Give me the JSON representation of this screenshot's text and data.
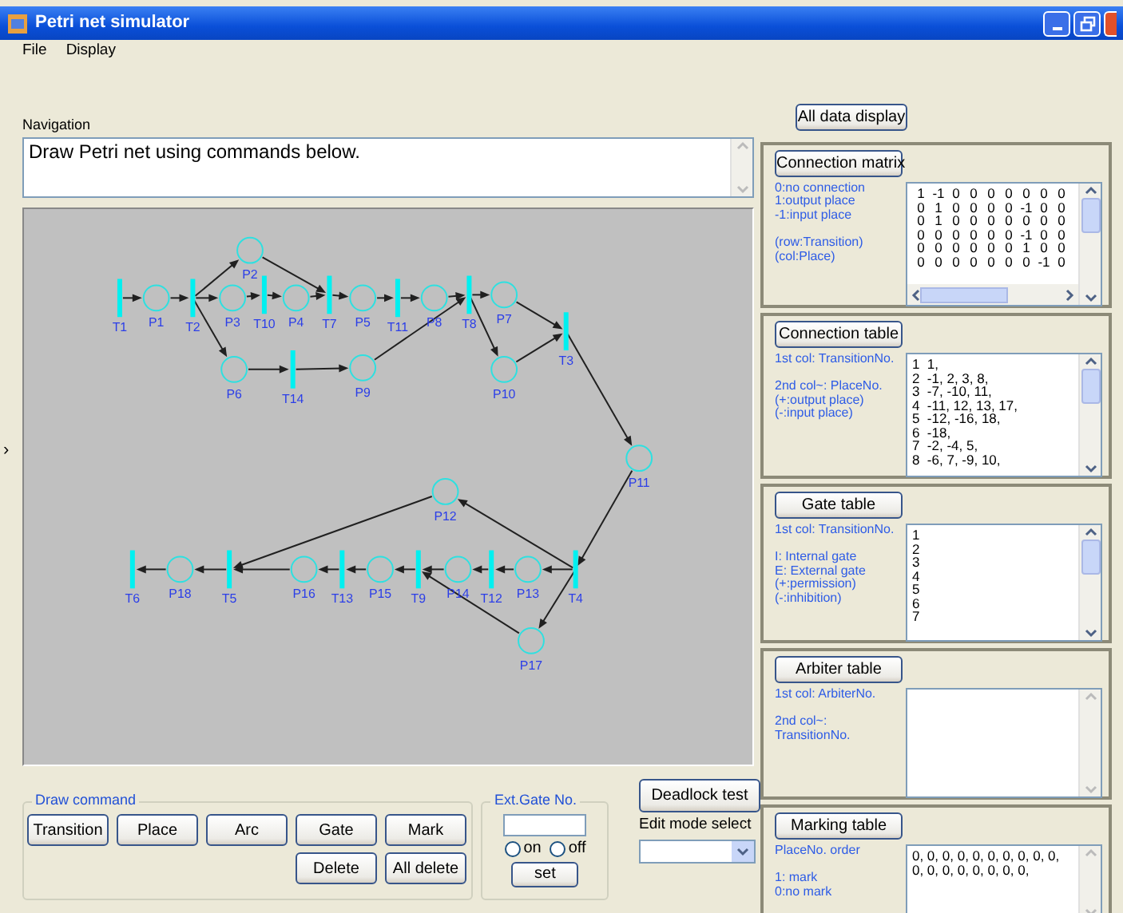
{
  "window": {
    "title": "Petri net simulator"
  },
  "menu": [
    "File",
    "Display"
  ],
  "navigation": {
    "label": "Navigation",
    "text": "Draw Petri net using commands below."
  },
  "side_marker": "›",
  "net": {
    "nodes": [
      {
        "label": "T1",
        "kind": "transition"
      },
      {
        "label": "P1",
        "kind": "place"
      },
      {
        "label": "T2",
        "kind": "transition"
      },
      {
        "label": "P2",
        "kind": "place"
      },
      {
        "label": "P3",
        "kind": "place"
      },
      {
        "label": "T10",
        "kind": "transition"
      },
      {
        "label": "P4",
        "kind": "place"
      },
      {
        "label": "T7",
        "kind": "transition"
      },
      {
        "label": "P5",
        "kind": "place"
      },
      {
        "label": "T11",
        "kind": "transition"
      },
      {
        "label": "P8",
        "kind": "place"
      },
      {
        "label": "T8",
        "kind": "transition"
      },
      {
        "label": "P7",
        "kind": "place"
      },
      {
        "label": "T3",
        "kind": "transition"
      },
      {
        "label": "P6",
        "kind": "place"
      },
      {
        "label": "T14",
        "kind": "transition"
      },
      {
        "label": "P9",
        "kind": "place"
      },
      {
        "label": "P10",
        "kind": "place"
      },
      {
        "label": "P11",
        "kind": "place"
      },
      {
        "label": "P12",
        "kind": "place"
      },
      {
        "label": "T6",
        "kind": "transition"
      },
      {
        "label": "P18",
        "kind": "place"
      },
      {
        "label": "T5",
        "kind": "transition"
      },
      {
        "label": "P16",
        "kind": "place"
      },
      {
        "label": "T13",
        "kind": "transition"
      },
      {
        "label": "P15",
        "kind": "place"
      },
      {
        "label": "T9",
        "kind": "transition"
      },
      {
        "label": "P14",
        "kind": "place"
      },
      {
        "label": "T12",
        "kind": "transition"
      },
      {
        "label": "P13",
        "kind": "place"
      },
      {
        "label": "T4",
        "kind": "transition"
      },
      {
        "label": "P17",
        "kind": "place"
      }
    ]
  },
  "draw_command": {
    "legend": "Draw command",
    "buttons": [
      "Transition",
      "Place",
      "Arc",
      "Gate",
      "Mark",
      "Delete",
      "All delete"
    ]
  },
  "ext_gate": {
    "legend": "Ext.Gate No.",
    "radios": [
      {
        "label": "on",
        "selected": false
      },
      {
        "label": "off",
        "selected": false
      }
    ],
    "button": "set"
  },
  "deadlock_button": "Deadlock test",
  "edit_mode": {
    "label": "Edit mode select"
  },
  "all_data_button": "All data display",
  "panels": [
    {
      "title": "Connection matrix",
      "scrollable": true,
      "notes": [
        [
          "0:no connection",
          "1:output place",
          "-1:input place"
        ],
        [
          "(row:Transition)",
          "(col:Place)"
        ]
      ],
      "matrix": [
        [
          "1",
          "-1",
          "0",
          "0",
          "0",
          "0",
          "0",
          "0",
          "0"
        ],
        [
          "0",
          "1",
          "0",
          "0",
          "0",
          "0",
          "-1",
          "0",
          "0"
        ],
        [
          "0",
          "1",
          "0",
          "0",
          "0",
          "0",
          "0",
          "0",
          "0"
        ],
        [
          "0",
          "0",
          "0",
          "0",
          "0",
          "0",
          "-1",
          "0",
          "0"
        ],
        [
          "0",
          "0",
          "0",
          "0",
          "0",
          "0",
          "1",
          "0",
          "0"
        ],
        [
          "0",
          "0",
          "0",
          "0",
          "0",
          "0",
          "0",
          "-1",
          "0"
        ]
      ]
    },
    {
      "title": "Connection table",
      "scrollable": true,
      "notes": [
        [
          "1st col: TransitionNo."
        ],
        [
          "2nd col~: PlaceNo.",
          "(+:output place)",
          "(-:input place)"
        ]
      ],
      "lines": [
        "1  1,",
        "2  -1, 2, 3, 8,",
        "3  -7, -10, 11,",
        "4  -11, 12, 13, 17,",
        "5  -12, -16, 18,",
        "6  -18,",
        "7  -2, -4, 5,",
        "8  -6, 7, -9, 10,"
      ]
    },
    {
      "title": "Gate table",
      "scrollable": true,
      "notes": [
        [
          "1st col: TransitionNo."
        ],
        [
          "I: Internal gate",
          "E: External gate",
          "(+:permission)",
          "(-:inhibition)"
        ]
      ],
      "lines": [
        "1",
        "2",
        "3",
        "4",
        "5",
        "6",
        "7"
      ]
    },
    {
      "title": "Arbiter table",
      "scrollable": false,
      "notes": [
        [
          "1st col: ArbiterNo."
        ],
        [
          "2nd col~:",
          "TransitionNo."
        ]
      ]
    },
    {
      "title": "Marking table",
      "scrollable": false,
      "notes": [
        [
          "PlaceNo. order"
        ],
        [
          "1: mark",
          "0:no mark"
        ]
      ],
      "lines": [
        "0, 0, 0, 0, 0, 0, 0, 0, 0, 0,",
        "0, 0, 0, 0, 0, 0, 0, 0,"
      ]
    }
  ]
}
